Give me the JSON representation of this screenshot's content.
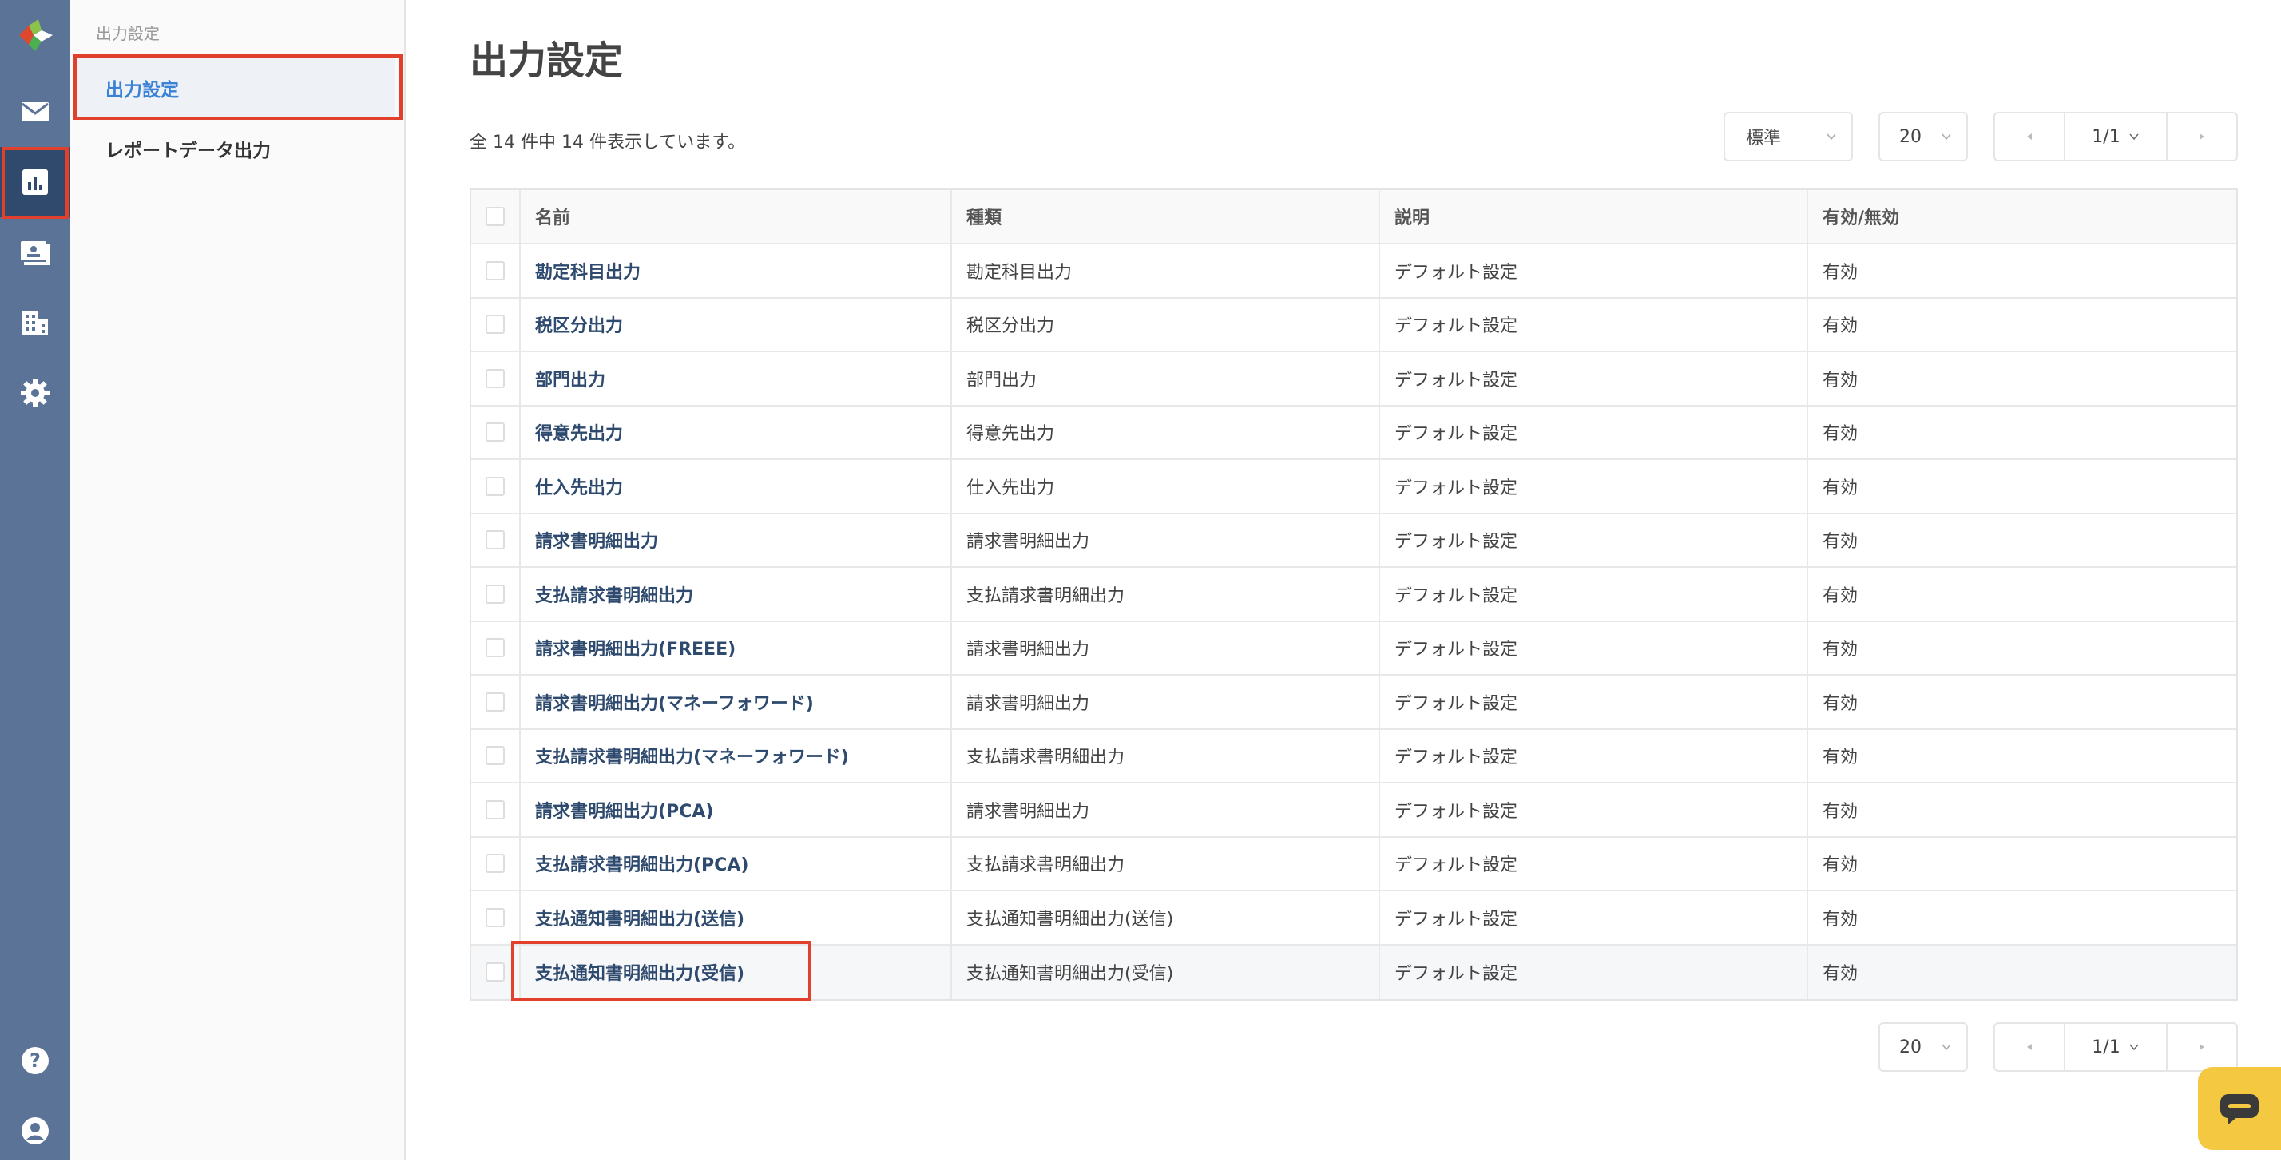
{
  "sidebar": {
    "section_label": "出力設定",
    "items": [
      {
        "label": "出力設定",
        "active": true
      },
      {
        "label": "レポートデータ出力",
        "active": false
      }
    ]
  },
  "rail": {
    "icons": [
      "logo-icon",
      "mail-icon",
      "report-icon",
      "invoice-icon",
      "building-icon",
      "gear-icon",
      "help-icon",
      "account-icon"
    ],
    "active": "report-icon",
    "accent": "#5a7397"
  },
  "page": {
    "title": "出力設定",
    "summary": "全 14 件中 14 件表示しています。"
  },
  "controls": {
    "sort_value": "標準",
    "per_page_top": "20",
    "page_top": "1/1",
    "per_page_bottom": "20",
    "page_bottom": "1/1"
  },
  "table": {
    "headers": [
      "名前",
      "種類",
      "説明",
      "有効/無効"
    ],
    "rows": [
      {
        "name": "勘定科目出力",
        "type": "勘定科目出力",
        "desc": "デフォルト設定",
        "status": "有効"
      },
      {
        "name": "税区分出力",
        "type": "税区分出力",
        "desc": "デフォルト設定",
        "status": "有効"
      },
      {
        "name": "部門出力",
        "type": "部門出力",
        "desc": "デフォルト設定",
        "status": "有効"
      },
      {
        "name": "得意先出力",
        "type": "得意先出力",
        "desc": "デフォルト設定",
        "status": "有効"
      },
      {
        "name": "仕入先出力",
        "type": "仕入先出力",
        "desc": "デフォルト設定",
        "status": "有効"
      },
      {
        "name": "請求書明細出力",
        "type": "請求書明細出力",
        "desc": "デフォルト設定",
        "status": "有効"
      },
      {
        "name": "支払請求書明細出力",
        "type": "支払請求書明細出力",
        "desc": "デフォルト設定",
        "status": "有効"
      },
      {
        "name": "請求書明細出力(FREEE)",
        "type": "請求書明細出力",
        "desc": "デフォルト設定",
        "status": "有効"
      },
      {
        "name": "請求書明細出力(マネーフォワード)",
        "type": "請求書明細出力",
        "desc": "デフォルト設定",
        "status": "有効"
      },
      {
        "name": "支払請求書明細出力(マネーフォワード)",
        "type": "支払請求書明細出力",
        "desc": "デフォルト設定",
        "status": "有効"
      },
      {
        "name": "請求書明細出力(PCA)",
        "type": "請求書明細出力",
        "desc": "デフォルト設定",
        "status": "有効"
      },
      {
        "name": "支払請求書明細出力(PCA)",
        "type": "支払請求書明細出力",
        "desc": "デフォルト設定",
        "status": "有効"
      },
      {
        "name": "支払通知書明細出力(送信)",
        "type": "支払通知書明細出力(送信)",
        "desc": "デフォルト設定",
        "status": "有効"
      },
      {
        "name": "支払通知書明細出力(受信)",
        "type": "支払通知書明細出力(受信)",
        "desc": "デフォルト設定",
        "status": "有効"
      }
    ]
  }
}
